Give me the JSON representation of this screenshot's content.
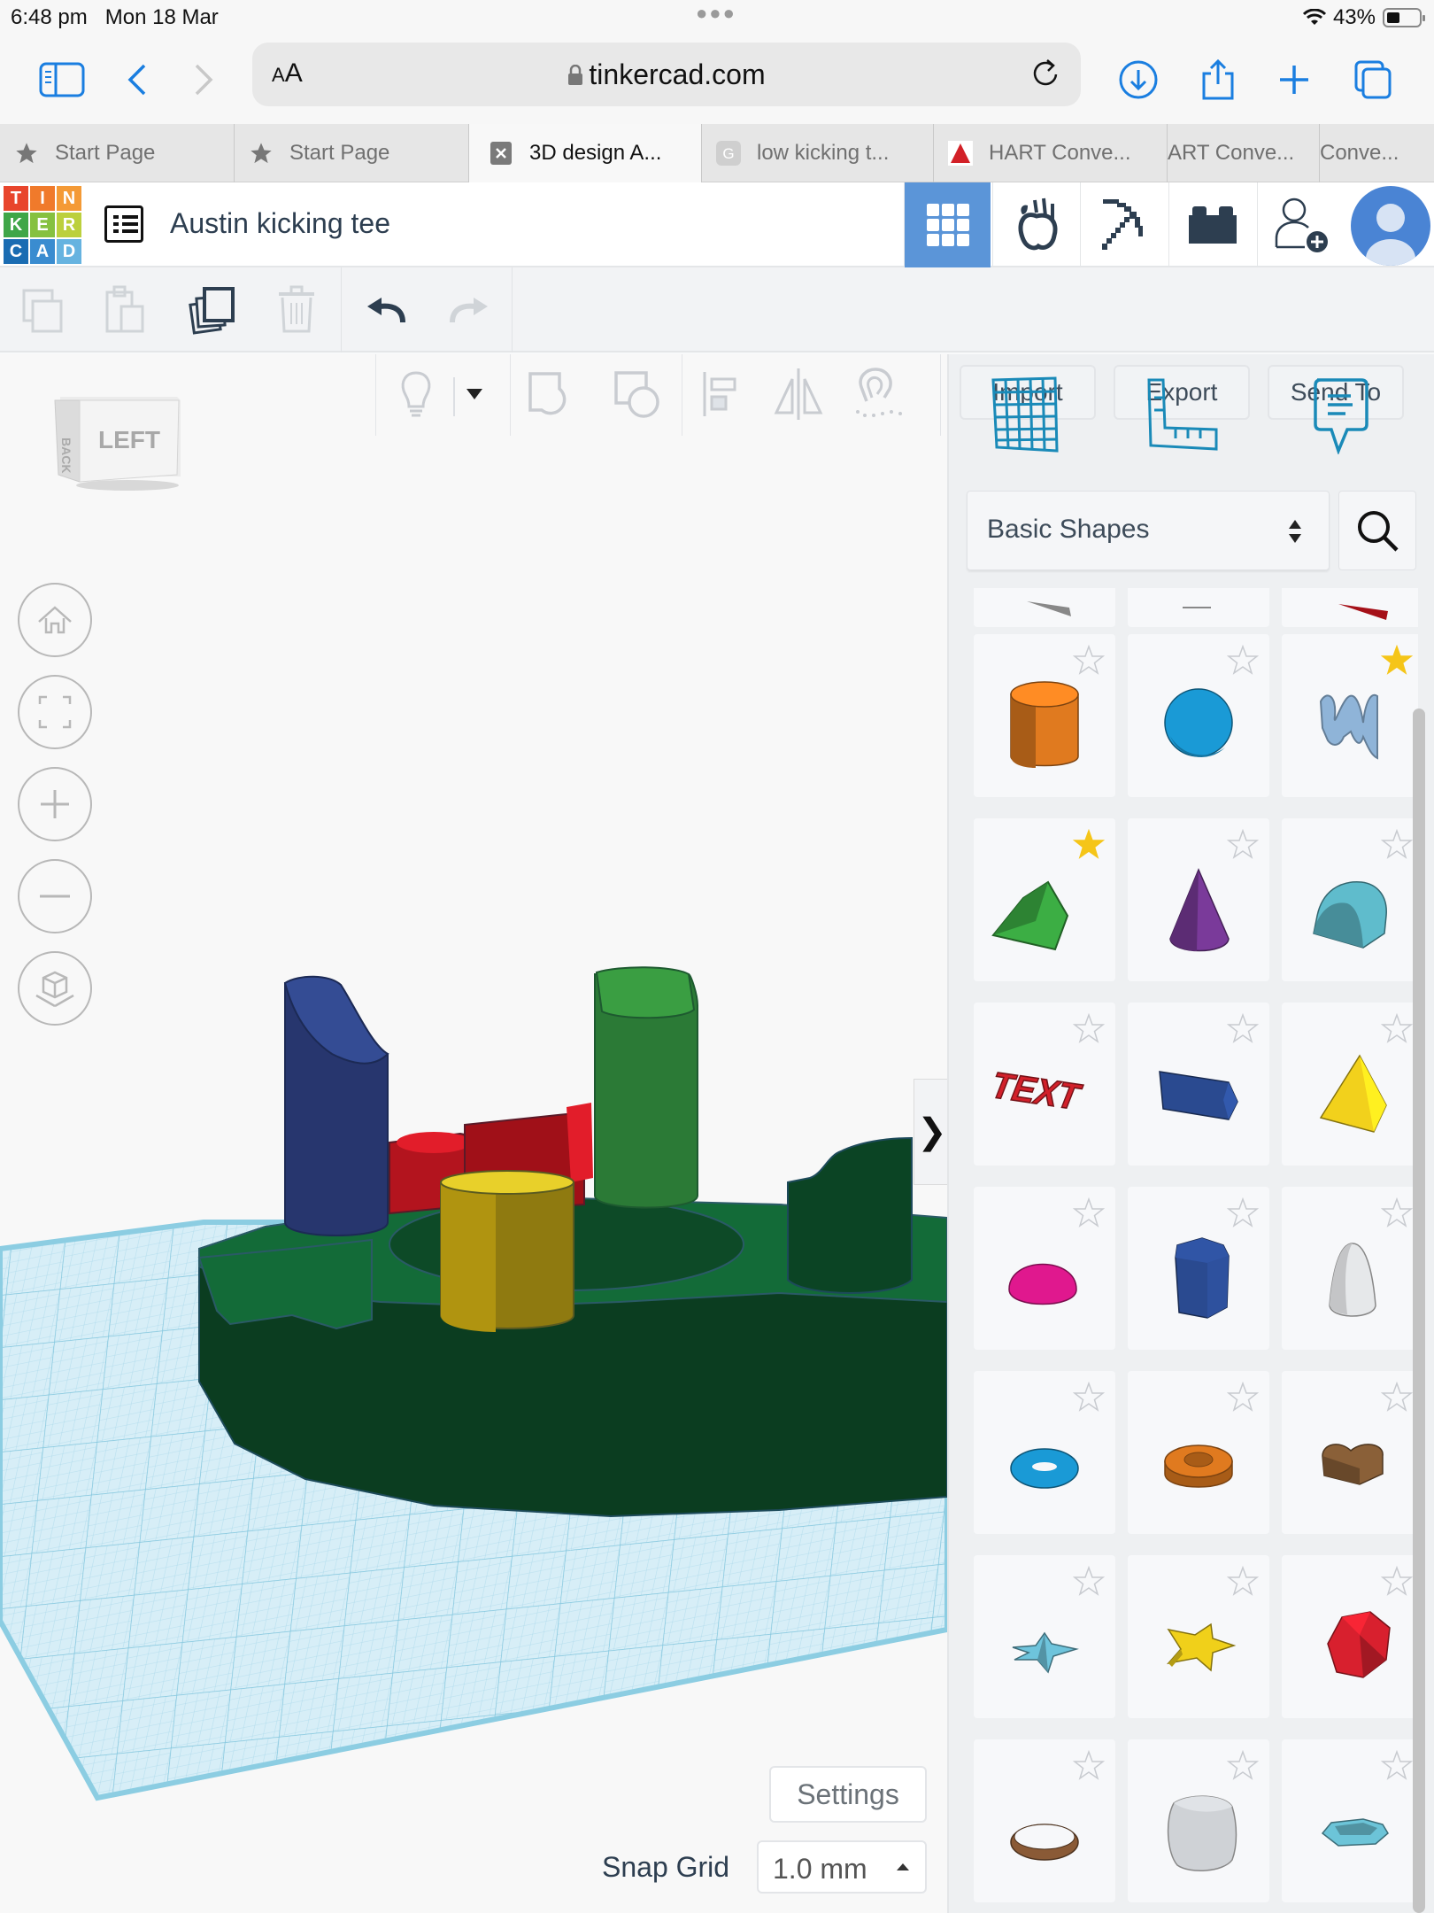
{
  "status_bar": {
    "time": "6:48 pm",
    "date": "Mon 18 Mar",
    "battery_percent": "43%",
    "battery_level": 0.43
  },
  "browser": {
    "aa_label_small": "A",
    "aa_label_large": "A",
    "url": "tinkercad.com",
    "tabs": [
      {
        "label": "Start Page",
        "icon": "star-icon",
        "active": false
      },
      {
        "label": "Start Page",
        "icon": "star-icon",
        "active": false
      },
      {
        "label": "3D design A...",
        "icon": "close-icon",
        "active": true
      },
      {
        "label": "low kicking t...",
        "icon": "google-icon",
        "active": false
      },
      {
        "label": "HART Conve...",
        "icon": "triangle-logo-icon",
        "active": false
      },
      {
        "label": "ART Conve...",
        "icon": "",
        "active": false
      },
      {
        "label": "Conve...",
        "icon": "",
        "active": false
      }
    ]
  },
  "header": {
    "logo_letters": [
      "T",
      "I",
      "N",
      "K",
      "E",
      "R",
      "C",
      "A",
      "D"
    ],
    "logo_colors": [
      "#e8452c",
      "#f07a2b",
      "#f49a36",
      "#3fa648",
      "#86c140",
      "#bcd03d",
      "#1a6cb2",
      "#3a8cd0",
      "#66b3e0"
    ],
    "design_title": "Austin kicking tee",
    "active_view": "3d-design",
    "accent_color": "#5b95d8"
  },
  "viewport": {
    "view_cube_face": "LEFT",
    "view_cube_side": "BACK",
    "panel_toggle": "❯",
    "settings_label": "Settings",
    "snap_grid_label": "Snap Grid",
    "snap_grid_value": "1.0 mm"
  },
  "panel": {
    "import_label": "Import",
    "export_label": "Export",
    "send_to_label": "Send To",
    "category": "Basic Shapes",
    "shapes": [
      {
        "name": "Cylinder",
        "color": "#e07a1f",
        "favorite": false
      },
      {
        "name": "Sphere",
        "color": "#1a9ad6",
        "favorite": false
      },
      {
        "name": "Scribble",
        "color": "#8fb4d8",
        "favorite": true
      },
      {
        "name": "Roof",
        "color": "#3cae44",
        "favorite": true
      },
      {
        "name": "Cone",
        "color": "#7a3a9a",
        "favorite": false
      },
      {
        "name": "Round Roof",
        "color": "#5fbccc",
        "favorite": false
      },
      {
        "name": "Text",
        "color": "#d2202a",
        "favorite": false
      },
      {
        "name": "Polygon",
        "color": "#2a4a90",
        "favorite": false
      },
      {
        "name": "Pyramid",
        "color": "#f2d11c",
        "favorite": false
      },
      {
        "name": "Half Sphere",
        "color": "#e0188e",
        "favorite": false
      },
      {
        "name": "Polygon Prism",
        "color": "#2a4a90",
        "favorite": false
      },
      {
        "name": "Paraboloid",
        "color": "#e6e8ea",
        "favorite": false
      },
      {
        "name": "Torus",
        "color": "#1a9ad6",
        "favorite": false
      },
      {
        "name": "Tube",
        "color": "#e07a1f",
        "favorite": false
      },
      {
        "name": "Heart",
        "color": "#8a6038",
        "favorite": false
      },
      {
        "name": "Star",
        "color": "#6ec4dc",
        "favorite": false
      },
      {
        "name": "Star Extruded",
        "color": "#f0d01a",
        "favorite": false
      },
      {
        "name": "Icosahedron",
        "color": "#d8202e",
        "favorite": false
      },
      {
        "name": "Ring",
        "color": "#8a5a36",
        "favorite": false
      },
      {
        "name": "Rounded Box",
        "color": "#cfd2d6",
        "favorite": false
      },
      {
        "name": "Gem",
        "color": "#6cc4d8",
        "favorite": false
      }
    ]
  }
}
